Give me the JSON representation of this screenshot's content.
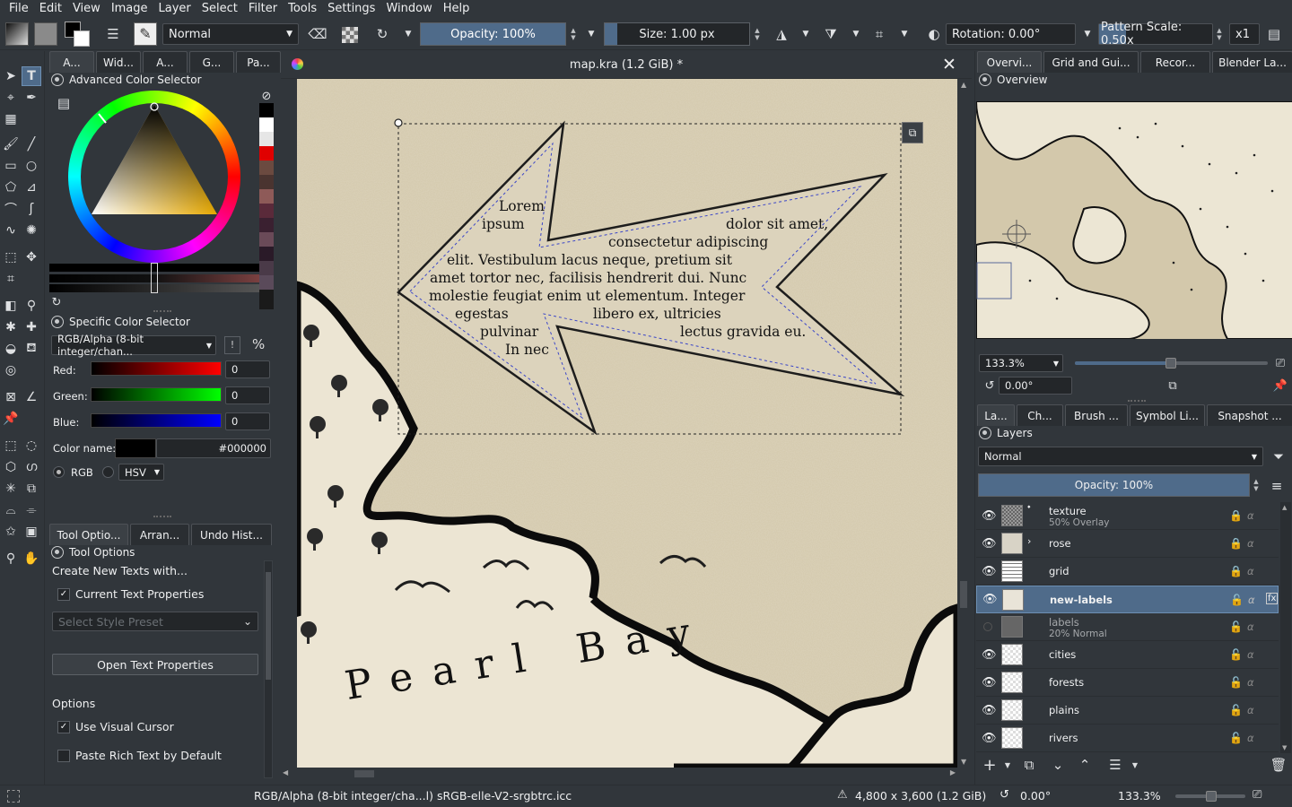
{
  "menu": [
    {
      "label": "File"
    },
    {
      "label": "Edit"
    },
    {
      "label": "View"
    },
    {
      "label": "Image"
    },
    {
      "label": "Layer"
    },
    {
      "label": "Select"
    },
    {
      "label": "Filter"
    },
    {
      "label": "Tools"
    },
    {
      "label": "Settings"
    },
    {
      "label": "Window"
    },
    {
      "label": "Help"
    }
  ],
  "toolbar": {
    "blend_mode": "Normal",
    "opacity": "Opacity: 100%",
    "size": "Size: 1.00 px",
    "rotation": "Rotation: 0.00°",
    "pattern_scale": "Pattern Scale: 0.50x",
    "zoom_factor": "x1"
  },
  "left_tabs": [
    "A...",
    "Wid...",
    "A...",
    "G...",
    "Pa..."
  ],
  "advanced_color": {
    "title": "Advanced Color Selector"
  },
  "specific_color": {
    "title": "Specific Color Selector",
    "model": "RGB/Alpha (8-bit integer/chan...",
    "red_label": "Red:",
    "red_value": "0",
    "green_label": "Green:",
    "green_value": "0",
    "blue_label": "Blue:",
    "blue_value": "0",
    "color_name_label": "Color name:",
    "color_hex": "#000000",
    "rgb_label": "RGB",
    "hsv_label": "HSV"
  },
  "bottom_left_tabs": [
    "Tool Optio...",
    "Arran...",
    "Undo Hist..."
  ],
  "tool_options": {
    "title": "Tool Options",
    "create_label": "Create New Texts with...",
    "current_text_props": "Current Text Properties",
    "style_preset_placeholder": "Select Style Preset",
    "open_text_props": "Open Text Properties",
    "options_heading": "Options",
    "use_visual_cursor": "Use Visual Cursor",
    "paste_rich_text": "Paste Rich Text by Default"
  },
  "document": {
    "title": "map.kra (1.2 GiB) *",
    "label_text": [
      "Lorem",
      "ipsum",
      "dolor sit amet,",
      "consectetur adipiscing",
      "elit. Vestibulum lacus neque, pretium sit",
      "amet tortor nec, facilisis hendrerit dui. Nunc",
      "molestie feugiat enim ut elementum. Integer",
      "egestas",
      "libero ex, ultricies",
      "pulvinar",
      "lectus gravida eu.",
      "In nec"
    ],
    "bay_label": "Pearl Bay"
  },
  "right_top_tabs": [
    "Overvi...",
    "Grid and Gui...",
    "Recor...",
    "Blender La..."
  ],
  "overview": {
    "title": "Overview",
    "zoom": "133.3%",
    "rotation": "0.00°"
  },
  "right_mid_tabs": [
    "La...",
    "Ch...",
    "Brush ...",
    "Symbol Li...",
    "Snapshot ..."
  ],
  "layers": {
    "title": "Layers",
    "blend_mode": "Normal",
    "opacity": "Opacity: 100%",
    "items": [
      {
        "name": "texture",
        "sub": "50% Overlay",
        "visible": true
      },
      {
        "name": "rose",
        "sub": "",
        "visible": true
      },
      {
        "name": "grid",
        "sub": "",
        "visible": true
      },
      {
        "name": "new-labels",
        "sub": "",
        "visible": true,
        "selected": true
      },
      {
        "name": "labels",
        "sub": "20% Normal",
        "visible": false
      },
      {
        "name": "cities",
        "sub": "",
        "visible": true
      },
      {
        "name": "forests",
        "sub": "",
        "visible": true
      },
      {
        "name": "plains",
        "sub": "",
        "visible": true
      },
      {
        "name": "rivers",
        "sub": "",
        "visible": true
      }
    ]
  },
  "status": {
    "color_space": "RGB/Alpha (8-bit integer/cha...l)  sRGB-elle-V2-srgbtrc.icc",
    "dimensions": "4,800 x 3,600 (1.2 GiB)",
    "rotation": "0.00°",
    "zoom": "133.3%"
  },
  "colors": {
    "bg": "#31363b",
    "dark": "#232629",
    "accent": "#4f6b8a",
    "parchment": "#d6ccb4"
  }
}
